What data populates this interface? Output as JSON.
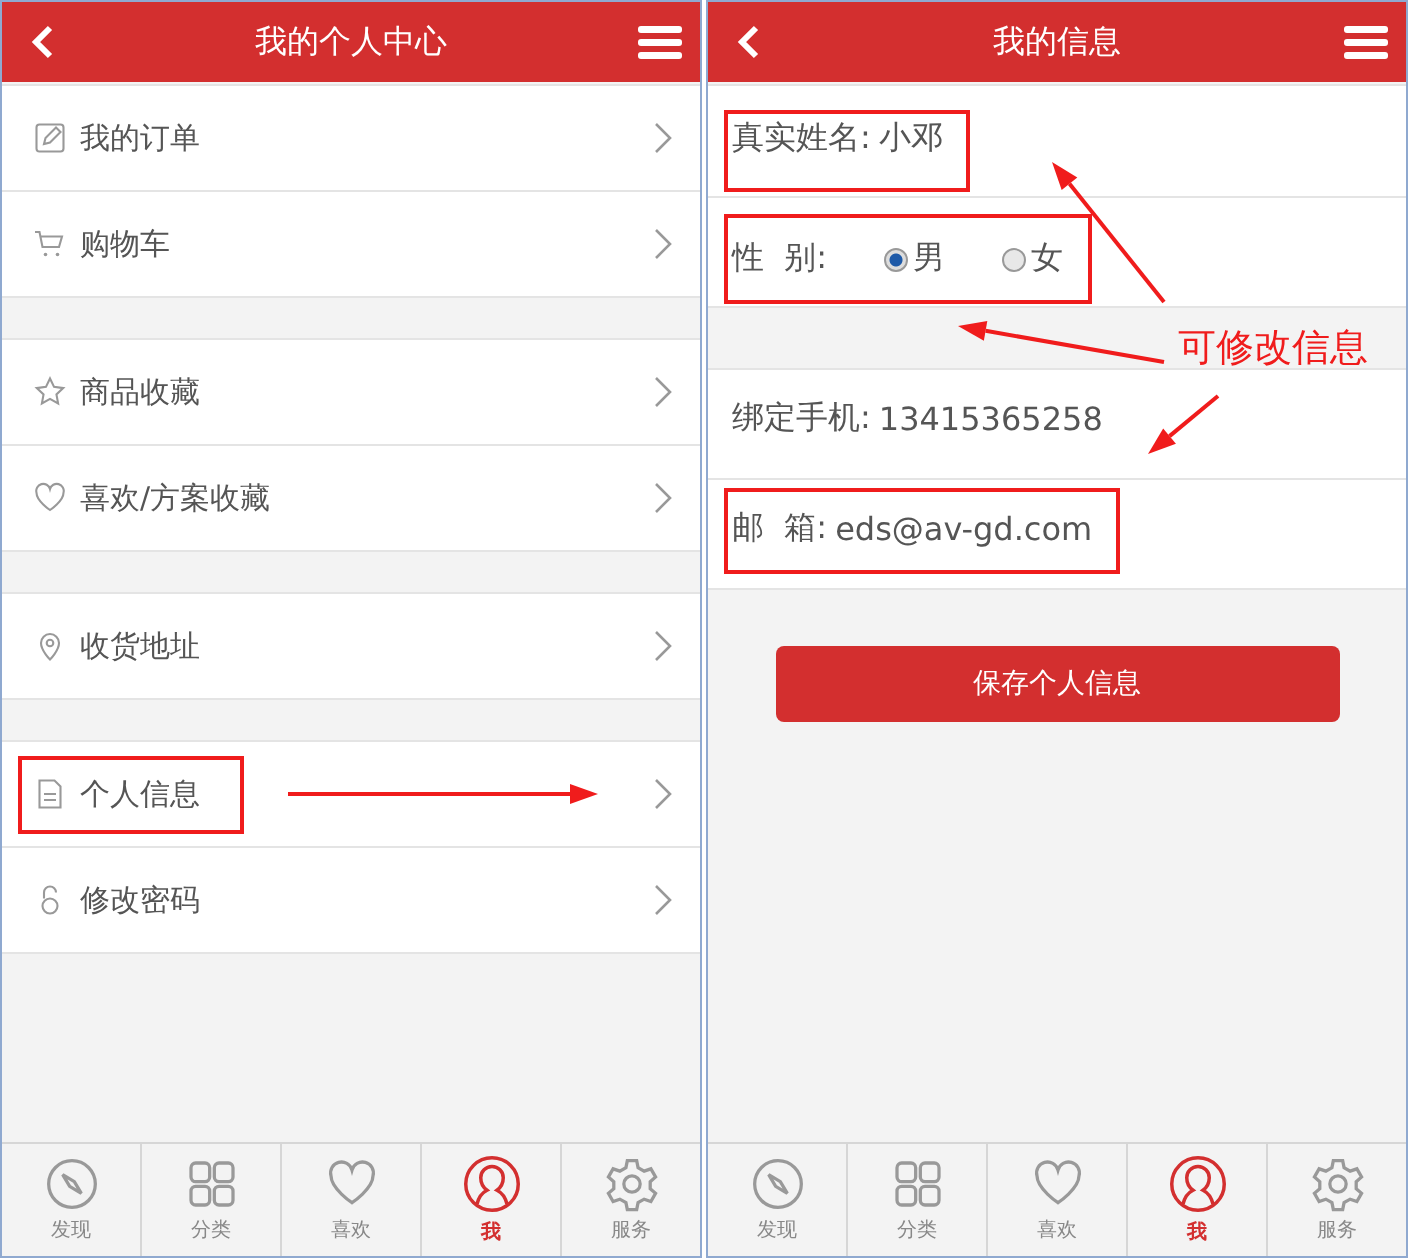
{
  "left_screen": {
    "header": {
      "title": "我的个人中心"
    },
    "groups": [
      [
        {
          "label": "我的订单",
          "kind": "pencil",
          "highlighted": false
        },
        {
          "label": "购物车",
          "kind": "cart",
          "highlighted": false
        }
      ],
      [
        {
          "label": "商品收藏",
          "kind": "star",
          "highlighted": false
        },
        {
          "label": "喜欢/方案收藏",
          "kind": "heart",
          "highlighted": false
        }
      ],
      [
        {
          "label": "收货地址",
          "kind": "pin",
          "highlighted": false
        }
      ],
      [
        {
          "label": "个人信息",
          "kind": "doc",
          "highlighted": true
        },
        {
          "label": "修改密码",
          "kind": "lock",
          "highlighted": false
        }
      ]
    ],
    "tabs": [
      {
        "label": "发现",
        "kind": "compass",
        "selected": false
      },
      {
        "label": "分类",
        "kind": "grid",
        "selected": false
      },
      {
        "label": "喜欢",
        "kind": "heart",
        "selected": false
      },
      {
        "label": "我",
        "kind": "user",
        "selected": true
      },
      {
        "label": "服务",
        "kind": "gear",
        "selected": false
      }
    ]
  },
  "right_screen": {
    "header": {
      "title": "我的信息"
    },
    "groups": [
      [
        {
          "kind": "text",
          "label": "真实姓名:",
          "value": "小邓",
          "highlighted": true
        },
        {
          "kind": "radio",
          "label": "性  别:",
          "options": [
            {
              "label": "男",
              "selected": true
            },
            {
              "label": "女",
              "selected": false
            }
          ],
          "highlighted": true
        }
      ],
      [
        {
          "kind": "text",
          "label": "绑定手机:",
          "value": "13415365258",
          "highlighted": false
        },
        {
          "kind": "text",
          "label": "邮  箱:",
          "value": "eds@av-gd.com",
          "highlighted": true
        }
      ]
    ],
    "save_button": "保存个人信息",
    "annotation": "可修改信息",
    "tabs": [
      {
        "label": "发现",
        "kind": "compass",
        "selected": false
      },
      {
        "label": "分类",
        "kind": "grid",
        "selected": false
      },
      {
        "label": "喜欢",
        "kind": "heart",
        "selected": false
      },
      {
        "label": "我",
        "kind": "user",
        "selected": true
      },
      {
        "label": "服务",
        "kind": "gear",
        "selected": false
      }
    ]
  }
}
